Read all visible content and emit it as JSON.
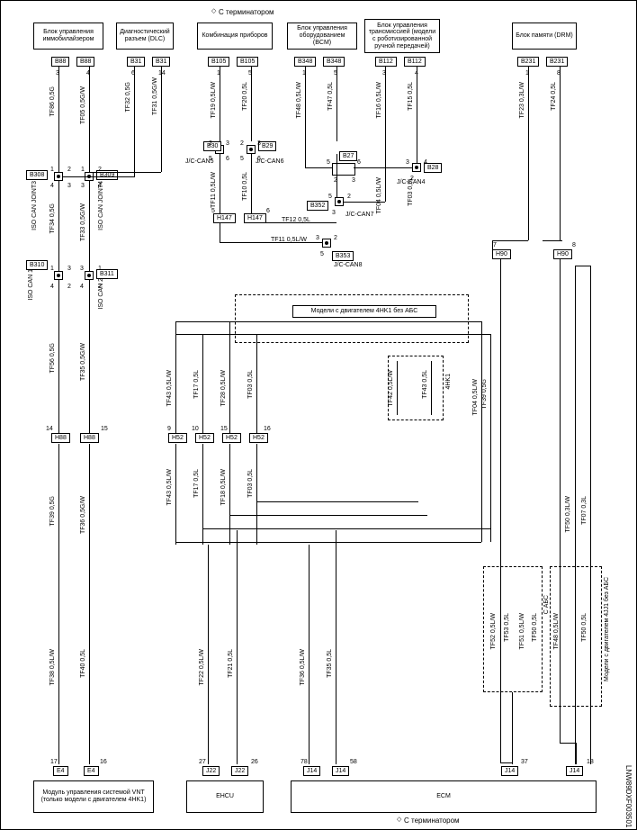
{
  "headers": {
    "top_terminator_left": "С терминатором",
    "top_terminator_right": "С терминатором",
    "bottom_terminator": "С терминатором"
  },
  "top_blocks": {
    "immobilizer": "Блок управления иммобилайзером",
    "diag": "Диагностический разъем (DLC)",
    "combi": "Комбинация приборов",
    "bcm": "Блок управления оборудованием (BCM)",
    "trans": "Блок управления трансмиссией (модели с роботизированной ручной передачей)",
    "drm": "Блок памяти (DRM)"
  },
  "bottom_blocks": {
    "vnt": "Модуль управления системой VNT (только модели с двигателем 4HK1)",
    "ehcu": "EHCU",
    "ecm": "ECM"
  },
  "notes": {
    "abs4hk1": "Модели с двигателем 4HK1 без АБС",
    "abs4jj1": "Модели с двигателем 4JJ1 без АБС",
    "model4hk1": "4HK1",
    "cabs": "C АБС"
  },
  "connectors": {
    "b88a": "B88",
    "b88b": "B88",
    "b31a": "B31",
    "b31b": "B31",
    "b105a": "B105",
    "b105b": "B105",
    "b348a": "B348",
    "b348b": "B348",
    "b112a": "B112",
    "b112b": "B112",
    "b231a": "B231",
    "b231b": "B231",
    "b308": "B308",
    "b309": "B309",
    "b30": "B30",
    "b29": "B29",
    "b27": "B27",
    "b28": "B28",
    "b352": "B352",
    "b353": "B353",
    "h147a": "H147",
    "h147b": "H147",
    "b310": "B310",
    "b311": "B311",
    "h88a": "H88",
    "h88b": "H88",
    "h52a": "H52",
    "h52b": "H52",
    "h52c": "H52",
    "h52d": "H52",
    "h90a": "H90",
    "h90b": "H90",
    "e4a": "E4",
    "e4b": "E4",
    "j22a": "J22",
    "j22b": "J22",
    "j14a": "J14",
    "j14b": "J14",
    "j14c": "J14",
    "j14d": "J14"
  },
  "joins": {
    "iso_can_joint3": "ISO CAN JOINT3",
    "iso_can_joint4": "ISO CAN JOINT4",
    "iso_can_1": "ISO CAN 1",
    "iso_can_2": "ISO CAN 2",
    "jc_can5": "J/C-CAN5",
    "jc_can6": "J/C-CAN6",
    "jc_can7": "J/C-CAN7",
    "jc_can8": "J/C-CAN8",
    "jc_can4": "J/C-CAN4"
  },
  "wires": {
    "tf86_05g": "TF86 0,5G",
    "tf05_05gw": "TF05 0,5G/W",
    "tf34_05g": "TF34 0,5G",
    "tf33_05gw": "TF33 0,5G/W",
    "tf56_05g": "TF56 0,5G",
    "tf35_05gw": "TF35 0,5G/W",
    "tf32_05g": "TF32 0,5G",
    "tf31_05gw": "TF31 0,5G/W",
    "tf19_05lw": "TF19 0,5L/W",
    "tf20_05l": "TF20 0,5L",
    "tf48_05lw": "TF48 0,5L/W",
    "tf47_05l": "TF47 0,5L",
    "tf16_05lw": "TF16 0,5L/W",
    "tf15_05l": "TF15 0,5L",
    "tf23_03lw": "TF23 0,3L/W",
    "tf24_05l": "TF24 0,5L",
    "tf11_05lw": "TF11 0,5L/W",
    "tf10_05l": "TF10 0,5L",
    "tf04_05lw": "TF04 0,5L/W",
    "tf03_05l": "TF03 0,5L",
    "tf12_05l": "TF12 0,5L",
    "tf11_05lw2": "TF11 0,5L/W",
    "tf43_05lw": "TF43 0,5L/W",
    "tf17_05l": "TF17 0,5L",
    "tf28_05lw": "TF28 0,5L/W",
    "tf03_05l2": "TF03 0,5L",
    "tf43_05lw2": "TF43 0,5L/W",
    "tf17_05l2": "TF17 0,5L",
    "tf18_05lw": "TF18 0,5L/W",
    "tf03_05l3": "TF03 0,5L",
    "tf42_05lw": "TF42 0,5L/W",
    "tf43_05l": "TF43 0,5L",
    "tf04_05lw2": "TF04 0,5L/W",
    "tf39_05g": "TF39 0,5G",
    "tf36_05gw": "TF36 0,5G/W",
    "tf38_05lw": "TF38 0,5L/W",
    "tf40_05l": "TF40 0,5L",
    "tf22_05lw": "TF22 0,5L/W",
    "tf21_05l": "TF21 0,5L",
    "tf36_05lw": "TF36 0,5L/W",
    "tf35_05l": "TF35 0,5L",
    "tf52_05lw": "TF52 0,5L/W",
    "tf53_05l": "TF53 0,5L",
    "tf50_03lw": "TF50 0,3L/W",
    "tf07_03l": "TF07 0,3L",
    "tf48_05lw2": "TF48 0,5L/W",
    "tf50_05l": "TF50 0,5L",
    "tf51_05lw": "TF51 0,5L/W",
    "tf50_05l2": "TF50 0,5L"
  },
  "pins": {
    "p1": "1",
    "p2": "2",
    "p3": "3",
    "p4": "4",
    "p5": "5",
    "p6": "6",
    "p7": "7",
    "p8": "8",
    "p9": "9",
    "p10": "10",
    "p14": "14",
    "p15": "15",
    "p16": "16",
    "p17": "17",
    "p18": "18",
    "p26": "26",
    "p27": "27",
    "p37": "37",
    "p58": "58",
    "p78": "78"
  },
  "doc_id": "LNW89DXF003501"
}
